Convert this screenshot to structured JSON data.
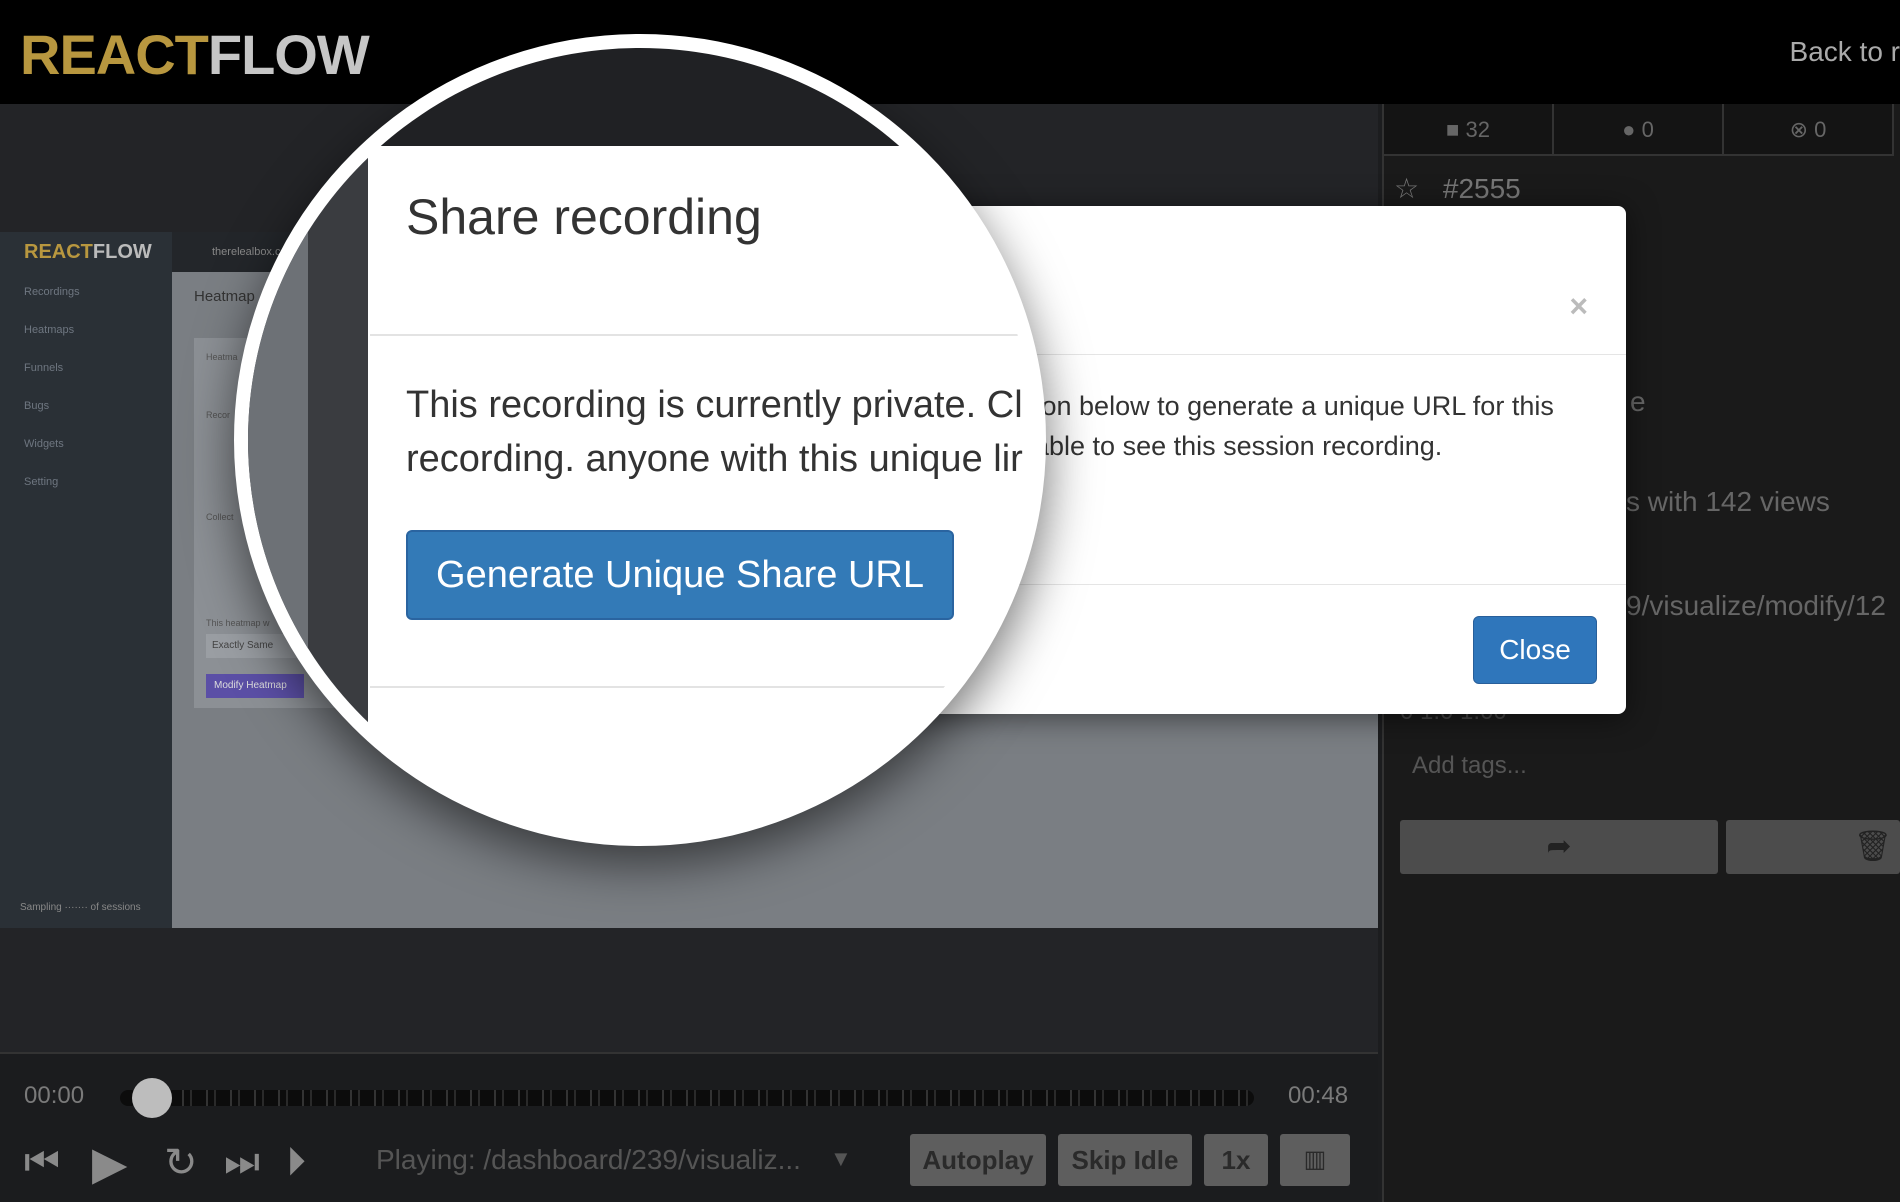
{
  "header": {
    "logo_react": "REACT",
    "logo_flow": "FLOW",
    "back_link": "Back to r"
  },
  "recording_preview": {
    "logo_react": "REACT",
    "logo_flow": "FLOW",
    "site": "therelealbox.co",
    "nav": [
      "Recordings",
      "Heatmaps",
      "Funnels",
      "Bugs",
      "Widgets",
      "Setting"
    ],
    "heading": "Heatmap",
    "card_labels": [
      "Heatma",
      "Recor",
      "Collect",
      "This heatmap w"
    ],
    "select_value": "Exactly Same",
    "button": "Modify Heatmap",
    "footer": "Sampling ······· of sessions"
  },
  "player": {
    "time_start": "00:00",
    "time_end": "00:48",
    "playing": "Playing: /dashboard/239/visualiz...",
    "buttons": {
      "autoplay": "Autoplay",
      "skip_idle": "Skip Idle",
      "speed": "1x"
    }
  },
  "sidebar": {
    "stats": {
      "videos": "32",
      "comments": "0",
      "errors": "0"
    },
    "recording_id": "#2555",
    "partial_e": "e",
    "views_text": "s with 142 views",
    "url_text": "9/visualize/modify/12",
    "time_text": "0 1.0 1.00",
    "tags_placeholder": "Add tags..."
  },
  "modal": {
    "title": "Share recording",
    "body_visible_right": "ton below to generate a unique URL for this",
    "body_visible_right_2": "able to see this session recording.",
    "close_x": "×",
    "close_button": "Close"
  },
  "magnifier": {
    "title": "Share recording",
    "line1": "This recording is currently private. Cl",
    "line2": "recording. anyone with this unique lir",
    "generate_button": "Generate Unique Share URL"
  }
}
